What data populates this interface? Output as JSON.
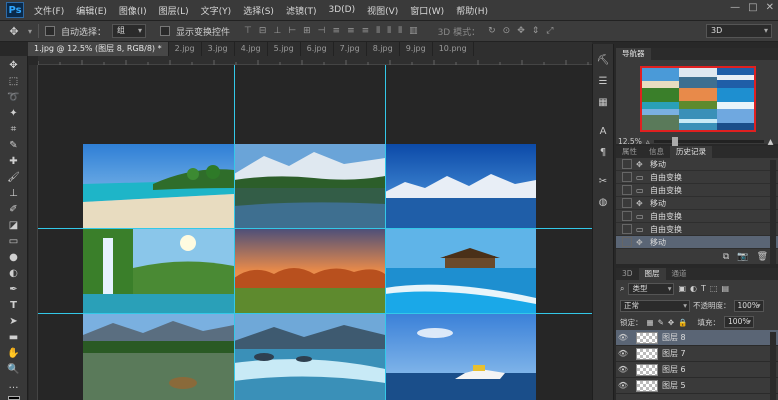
{
  "app": {
    "logo": "Ps"
  },
  "menu": [
    "文件(F)",
    "编辑(E)",
    "图像(I)",
    "图层(L)",
    "文字(Y)",
    "选择(S)",
    "滤镜(T)",
    "3D(D)",
    "视图(V)",
    "窗口(W)",
    "帮助(H)"
  ],
  "window_controls": [
    "—",
    "□",
    "✕"
  ],
  "options": {
    "auto_select_label": "自动选择：",
    "auto_select_value": "组",
    "show_transform_label": "显示变换控件",
    "mode_3d_label": "3D 模式：",
    "workspace_value": "3D"
  },
  "tabs": [
    {
      "label": "1.jpg @ 12.5% (图层 8, RGB/8) *",
      "active": true
    },
    {
      "label": "2.jpg",
      "active": false
    },
    {
      "label": "3.jpg",
      "active": false
    },
    {
      "label": "4.jpg",
      "active": false
    },
    {
      "label": "5.jpg",
      "active": false
    },
    {
      "label": "6.jpg",
      "active": false
    },
    {
      "label": "7.jpg",
      "active": false
    },
    {
      "label": "8.jpg",
      "active": false
    },
    {
      "label": "9.jpg",
      "active": false
    },
    {
      "label": "10.png",
      "active": false
    }
  ],
  "navigator": {
    "tab": "导航器",
    "zoom": "12.5%"
  },
  "history": {
    "tabs": [
      "属性",
      "信息",
      "历史记录"
    ],
    "items": [
      {
        "label": "移动",
        "selected": false
      },
      {
        "label": "自由变换",
        "selected": false
      },
      {
        "label": "自由变换",
        "selected": false
      },
      {
        "label": "移动",
        "selected": false
      },
      {
        "label": "自由变换",
        "selected": false
      },
      {
        "label": "自由变换",
        "selected": false
      },
      {
        "label": "移动",
        "selected": true
      }
    ]
  },
  "layers": {
    "tabs": [
      "3D",
      "图层",
      "通道"
    ],
    "filter_label": "类型",
    "blend_mode": "正常",
    "opacity_label": "不透明度：",
    "opacity_value": "100%",
    "lock_label": "锁定：",
    "fill_label": "填充：",
    "fill_value": "100%",
    "items": [
      {
        "name": "图层 8",
        "selected": true
      },
      {
        "name": "图层 7",
        "selected": false
      },
      {
        "name": "图层 6",
        "selected": false
      },
      {
        "name": "图层 5",
        "selected": false
      }
    ]
  }
}
